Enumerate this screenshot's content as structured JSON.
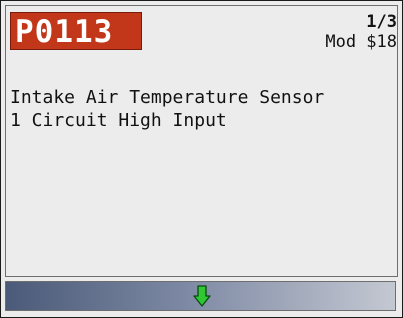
{
  "header": {
    "dtc_code": "P0113",
    "page_indicator": "1/3",
    "module": "Mod $18"
  },
  "description": {
    "line1": "Intake Air Temperature Sensor",
    "line2": "1 Circuit High Input"
  },
  "footer": {
    "scroll_icon": "down-arrow-icon",
    "arrow_color": "#2ec833",
    "bar_gradient_start": "#4a5a78",
    "bar_gradient_end": "#c4c8d2"
  },
  "colors": {
    "dtc_background": "#c23619",
    "screen_background": "#ececec"
  }
}
